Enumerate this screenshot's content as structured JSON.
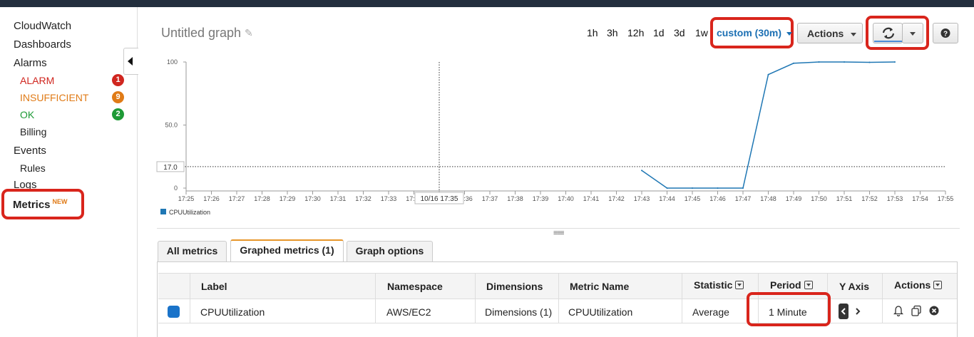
{
  "sidebar": {
    "cloudwatch": "CloudWatch",
    "dashboards": "Dashboards",
    "alarms": "Alarms",
    "alarm_states": [
      {
        "label": "ALARM",
        "count": "1",
        "color": "#d0261f"
      },
      {
        "label": "INSUFFICIENT",
        "count": "9",
        "color": "#e07b17"
      },
      {
        "label": "OK",
        "count": "2",
        "color": "#1e9a36"
      }
    ],
    "billing": "Billing",
    "events": "Events",
    "rules": "Rules",
    "logs": "Logs",
    "metrics": "Metrics",
    "metrics_badge": "NEW"
  },
  "header": {
    "title": "Untitled graph",
    "time_ranges": [
      "1h",
      "3h",
      "12h",
      "1d",
      "3d",
      "1w"
    ],
    "custom_range": "custom (30m)",
    "actions_label": "Actions"
  },
  "chart_data": {
    "type": "line",
    "yticks": [
      "100",
      "50.0",
      "0"
    ],
    "ylim": [
      0,
      100
    ],
    "xticks": [
      "17:25",
      "17:26",
      "17:27",
      "17:28",
      "17:29",
      "17:30",
      "17:31",
      "17:32",
      "17:33",
      "17:34",
      "17:35",
      "17:36",
      "17:37",
      "17:38",
      "17:39",
      "17:40",
      "17:41",
      "17:42",
      "17:43",
      "17:44",
      "17:45",
      "17:46",
      "17:47",
      "17:48",
      "17:49",
      "17:50",
      "17:51",
      "17:52",
      "17:53",
      "17:54",
      "17:55"
    ],
    "series": [
      {
        "name": "CPUUtilization",
        "color": "#1f77b4",
        "x": [
          "17:43",
          "17:44",
          "17:45",
          "17:46",
          "17:47",
          "17:48",
          "17:49",
          "17:50",
          "17:51",
          "17:52",
          "17:53"
        ],
        "y": [
          14,
          0,
          0,
          0,
          0,
          90,
          99,
          100,
          100,
          99.7,
          100
        ]
      }
    ],
    "threshold": {
      "value": 17.0,
      "label": "17.0"
    },
    "cursor": {
      "time": "17:35",
      "label": "10/16 17:35"
    },
    "legend_position": "bottom-left"
  },
  "tabs": [
    "All metrics",
    "Graphed metrics (1)",
    "Graph options"
  ],
  "table": {
    "headers": [
      "Label",
      "Namespace",
      "Dimensions",
      "Metric Name",
      "Statistic",
      "Period",
      "Y Axis",
      "Actions"
    ],
    "row": {
      "color": "#1a73c9",
      "label": "CPUUtilization",
      "namespace": "AWS/EC2",
      "dimensions": "Dimensions (1)",
      "metric_name": "CPUUtilization",
      "statistic": "Average",
      "period": "1 Minute"
    }
  }
}
